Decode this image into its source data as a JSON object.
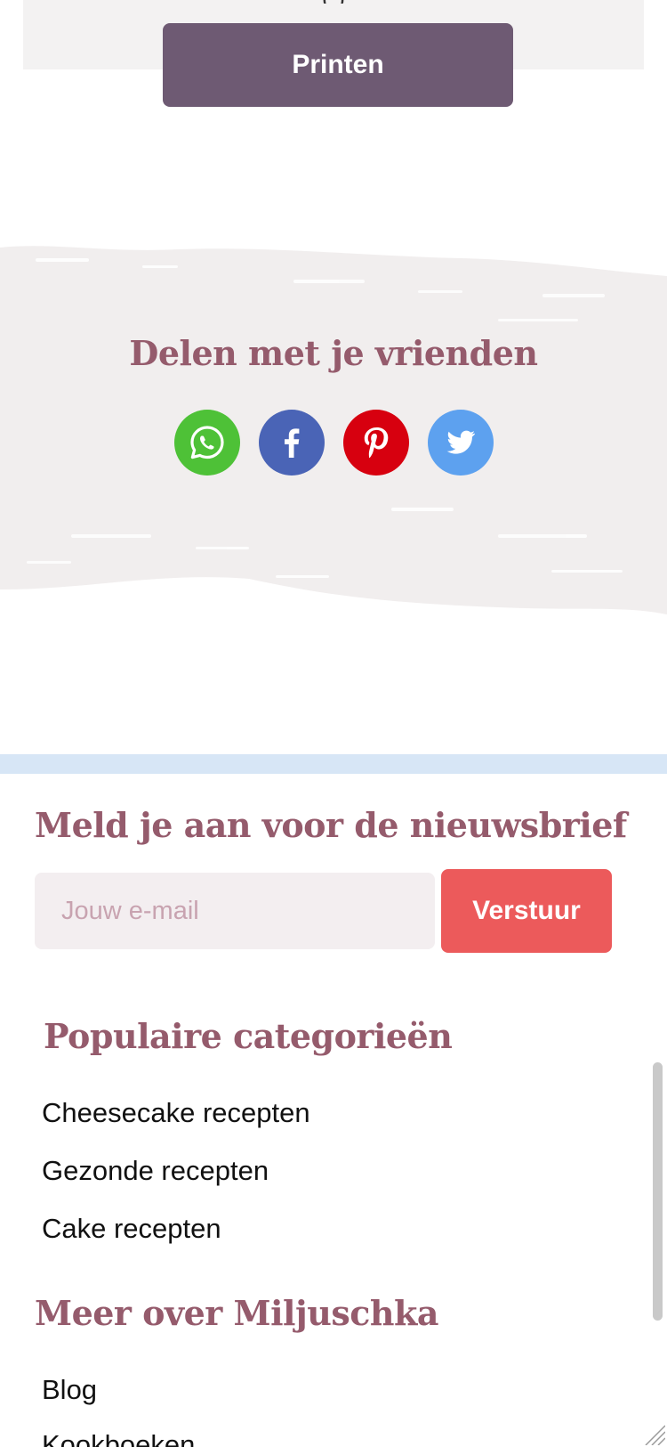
{
  "print": {
    "button_label": "Printen",
    "cutoff_text": "(          )"
  },
  "share": {
    "title": "Delen met je vrienden",
    "icons": [
      {
        "name": "whatsapp-icon",
        "color": "#4ec137"
      },
      {
        "name": "facebook-icon",
        "color": "#4a64b6"
      },
      {
        "name": "pinterest-icon",
        "color": "#d7000f"
      },
      {
        "name": "twitter-icon",
        "color": "#5da1ef"
      }
    ]
  },
  "newsletter": {
    "title": "Meld je aan voor de nieuwsbrief",
    "email_placeholder": "Jouw e-mail",
    "email_value": "",
    "submit_label": "Verstuur"
  },
  "categories": {
    "title": "Populaire categorieën",
    "items": [
      "Cheesecake recepten",
      "Gezonde recepten",
      "Cake recepten"
    ]
  },
  "more": {
    "title": "Meer over Miljuschka",
    "items": [
      "Blog",
      "Kookboeken"
    ]
  },
  "colors": {
    "heading": "#955b6c",
    "print_button": "#6e5a73",
    "send_button": "#ec5a5b",
    "divider": "#d7e6f6"
  }
}
